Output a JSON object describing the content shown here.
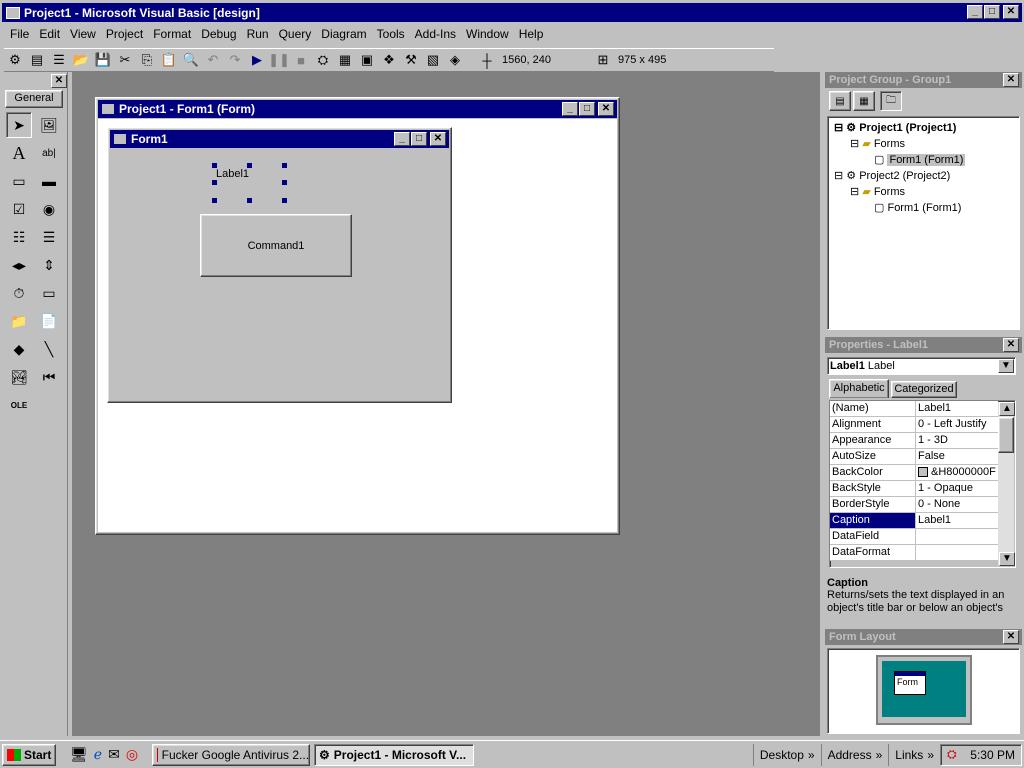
{
  "app": {
    "title": "Project1 - Microsoft Visual Basic [design]"
  },
  "menu": [
    "File",
    "Edit",
    "View",
    "Project",
    "Format",
    "Debug",
    "Run",
    "Query",
    "Diagram",
    "Tools",
    "Add-Ins",
    "Window",
    "Help"
  ],
  "toolbar": {
    "position": "1560, 240",
    "size": "975 x 495"
  },
  "toolbox": {
    "tab_label": "General"
  },
  "mdi_form": {
    "title": "Project1 - Form1 (Form)",
    "inner_title": "Form1",
    "label_caption": "Label1",
    "button_caption": "Command1"
  },
  "project_explorer": {
    "title": "Project Group - Group1",
    "items": [
      {
        "label": "Project1 (Project1)",
        "bold": true
      },
      {
        "label": "Forms"
      },
      {
        "label": "Form1 (Form1)"
      },
      {
        "label": "Project2 (Project2)"
      },
      {
        "label": "Forms"
      },
      {
        "label": "Form1 (Form1)"
      }
    ]
  },
  "properties": {
    "title": "Properties - Label1",
    "object_name": "Label1",
    "object_type": "Label",
    "tabs": [
      "Alphabetic",
      "Categorized"
    ],
    "rows": [
      {
        "k": "(Name)",
        "v": "Label1"
      },
      {
        "k": "Alignment",
        "v": "0 - Left Justify"
      },
      {
        "k": "Appearance",
        "v": "1 - 3D"
      },
      {
        "k": "AutoSize",
        "v": "False"
      },
      {
        "k": "BackColor",
        "v": "&H8000000F"
      },
      {
        "k": "BackStyle",
        "v": "1 - Opaque"
      },
      {
        "k": "BorderStyle",
        "v": "0 - None"
      },
      {
        "k": "Caption",
        "v": "Label1"
      },
      {
        "k": "DataField",
        "v": ""
      },
      {
        "k": "DataFormat",
        "v": ""
      }
    ],
    "desc_title": "Caption",
    "desc_text": "Returns/sets the text displayed in an object's title bar or below an object's"
  },
  "form_layout": {
    "title": "Form Layout",
    "mini_form_label": "Form"
  },
  "taskbar": {
    "start": "Start",
    "tasks": [
      "Fucker Google Antivirus 2...",
      "Project1 - Microsoft V..."
    ],
    "desktop": "Desktop",
    "address": "Address",
    "links": "Links",
    "clock": "5:30 PM"
  }
}
